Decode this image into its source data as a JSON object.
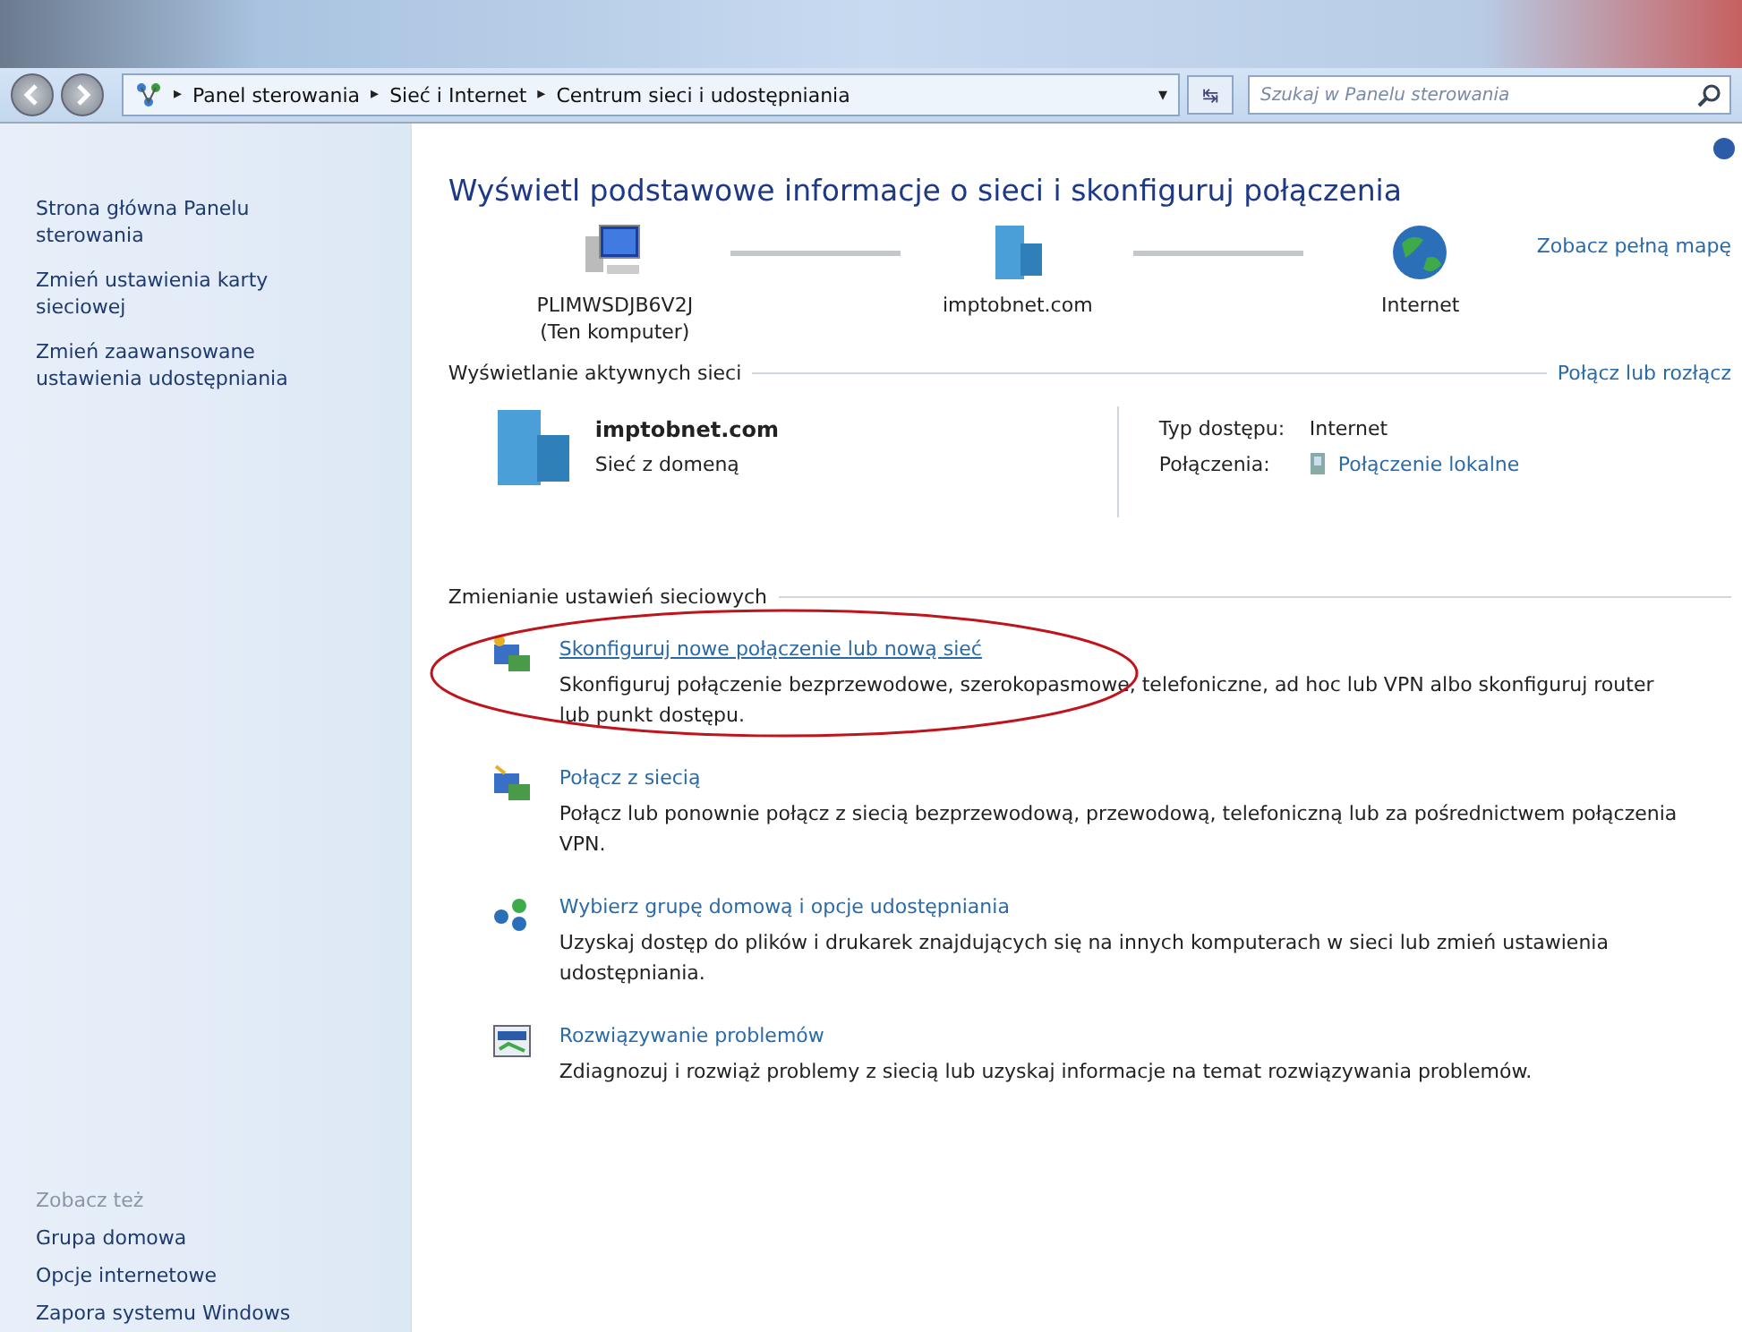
{
  "address_bar": {
    "breadcrumbs": [
      "Panel sterowania",
      "Sieć i Internet",
      "Centrum sieci i udostępniania"
    ],
    "separator": "▸",
    "dropdown": "▾",
    "refresh": "↹"
  },
  "search": {
    "placeholder": "Szukaj w Panelu sterowania"
  },
  "sidebar": {
    "items": [
      "Strona główna Panelu sterowania",
      "Zmień ustawienia karty sieciowej",
      "Zmień zaawansowane ustawienia udostępniania"
    ],
    "see_also": {
      "heading": "Zobacz też",
      "items": [
        "Grupa domowa",
        "Opcje internetowe",
        "Zapora systemu Windows"
      ]
    }
  },
  "title": "Wyświetl podstawowe informacje o sieci i skonfiguruj połączenia",
  "full_map_link": "Zobacz pełną mapę",
  "map": [
    {
      "kind": "computer",
      "label": "PLIMWSDJB6V2J",
      "sublabel": "(Ten komputer)"
    },
    {
      "kind": "domain",
      "label": "imptobnet.com"
    },
    {
      "kind": "globe",
      "label": "Internet"
    }
  ],
  "active_networks": {
    "heading": "Wyświetlanie aktywnych sieci",
    "link": "Połącz lub rozłącz",
    "name": "imptobnet.com",
    "type": "Sieć z domeną",
    "access_label": "Typ dostępu:",
    "access_value": "Internet",
    "connections_label": "Połączenia:",
    "connections_value": "Połączenie lokalne"
  },
  "change_settings": {
    "heading": "Zmienianie ustawień sieciowych",
    "tasks": [
      {
        "kind": "setup",
        "title": "Skonfiguruj nowe połączenie lub nową sieć",
        "description": "Skonfiguruj połączenie bezprzewodowe, szerokopasmowe, telefoniczne, ad hoc lub VPN albo skonfiguruj router lub punkt dostępu.",
        "circled": true
      },
      {
        "kind": "connect",
        "title": "Połącz z siecią",
        "description": "Połącz lub ponownie połącz z siecią bezprzewodową, przewodową, telefoniczną lub za pośrednictwem połączenia VPN.",
        "circled": false
      },
      {
        "kind": "homegroup",
        "title": "Wybierz grupę domową i opcje udostępniania",
        "description": "Uzyskaj dostęp do plików i drukarek znajdujących się na innych komputerach w sieci lub zmień ustawienia udostępniania.",
        "circled": false
      },
      {
        "kind": "troubleshoot",
        "title": "Rozwiązywanie problemów",
        "description": "Zdiagnozuj i rozwiąż problemy z siecią lub uzyskaj informacje na temat rozwiązywania problemów.",
        "circled": false
      }
    ]
  }
}
